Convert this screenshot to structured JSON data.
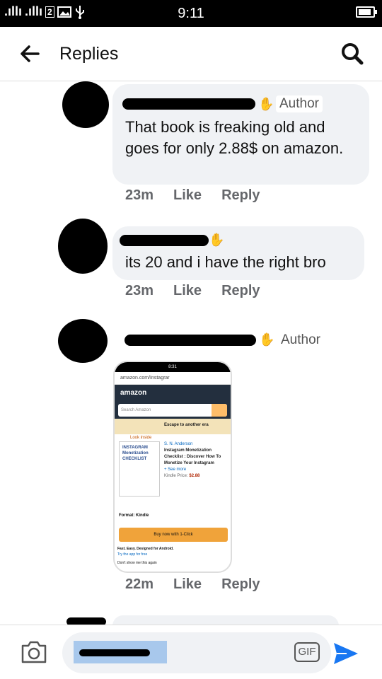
{
  "status_bar": {
    "time": "9:11",
    "signal_1": ".ıllı",
    "signal_2": ".ıllı",
    "sim_badge": "2",
    "battery_level": 0.9
  },
  "header": {
    "title": "Replies"
  },
  "comments": [
    {
      "author_badge": "Author",
      "text": "That book is freaking old and goes for only 2.88$ on amazon.",
      "time": "23m",
      "like": "Like",
      "reply": "Reply"
    },
    {
      "text": "its 20 and i have the right bro",
      "time": "23m",
      "like": "Like",
      "reply": "Reply"
    },
    {
      "author_badge": "Author",
      "time": "22m",
      "like": "Like",
      "reply": "Reply",
      "attachment": {
        "status_time": "8:31",
        "url": "amazon.com/Instagrar",
        "logo": "amazon",
        "search_placeholder": "Search Amazon",
        "banner": "Escape to another era",
        "look_inside": "Look inside",
        "book_cover": "INSTAGRAM Monetization CHECKLIST",
        "author": "S. N. Anderson",
        "book_title": "Instagram Monetization Checklist : Discover How To Monetize Your Instagram",
        "see_more": "+ See more",
        "kindle_price_label": "Kindle Price:",
        "kindle_price": "$2.88",
        "format": "Format: Kindle",
        "buy_button": "Buy now with 1-Click",
        "promo": "Fast. Easy. Designed for Android.",
        "promo_link": "Try the app for free",
        "dont_show": "Don't show me this again"
      }
    }
  ],
  "composer": {
    "gif_label": "GIF"
  }
}
